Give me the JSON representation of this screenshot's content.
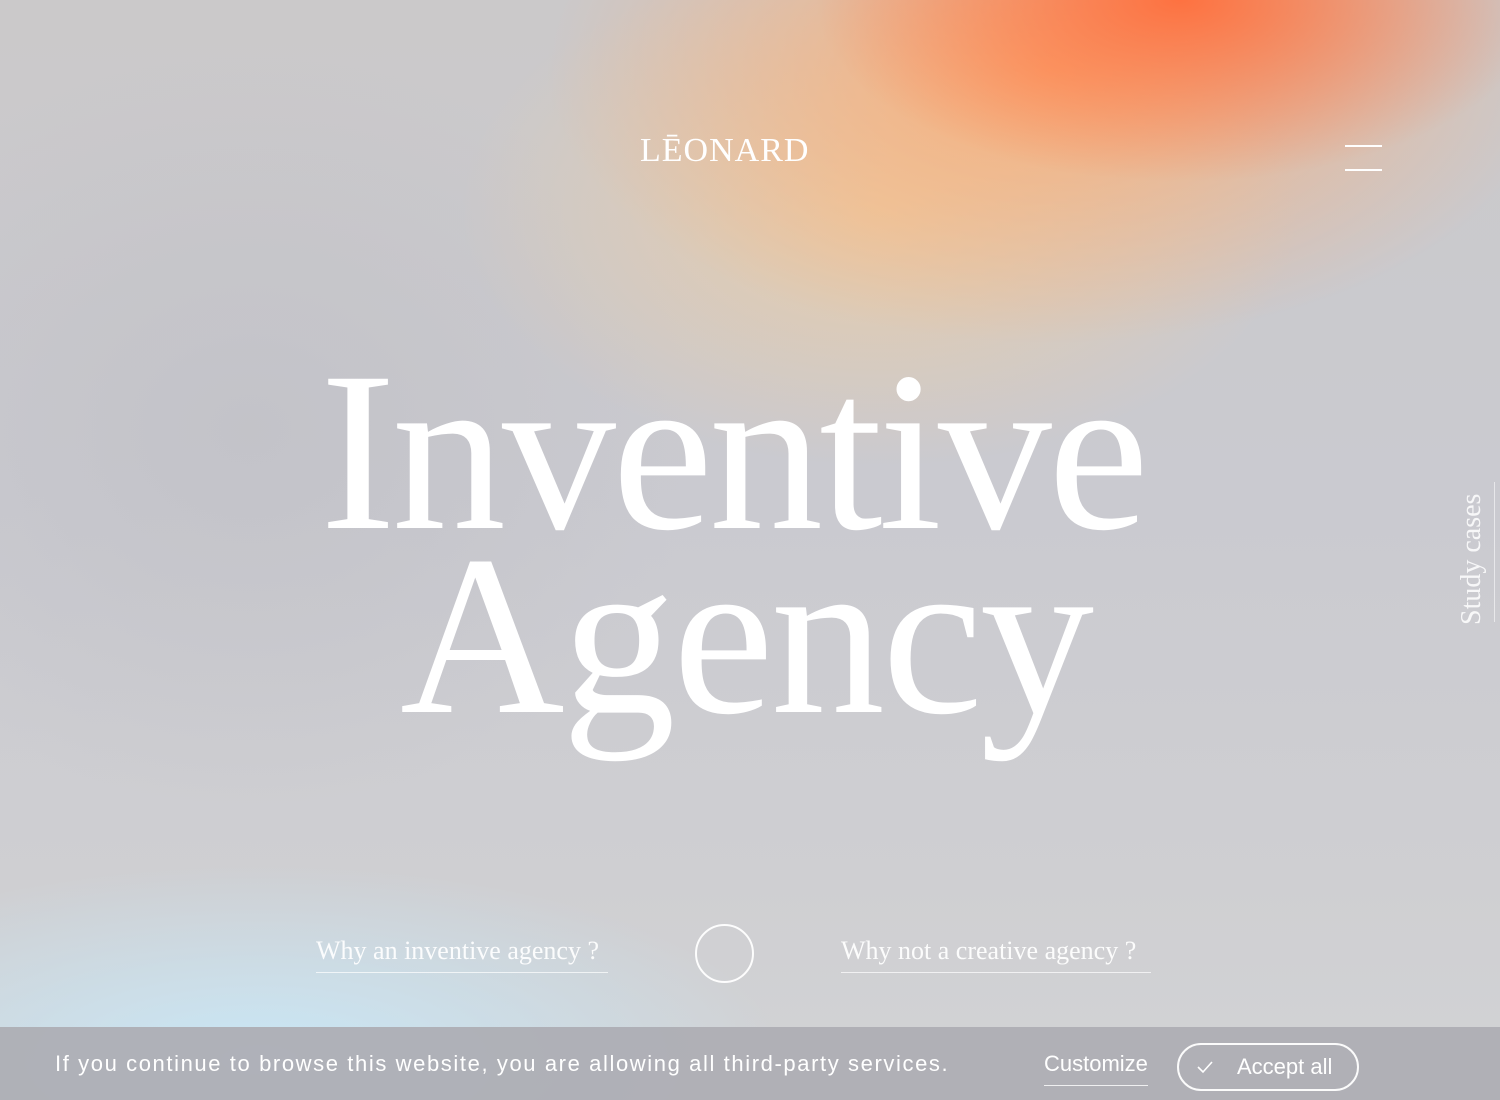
{
  "header": {
    "logo_text": "LĒONARD",
    "menu_icon": "hamburger-menu-icon"
  },
  "hero": {
    "line1": "Inventive",
    "line2": "Agency"
  },
  "side_nav": {
    "study_cases_label": "Study cases"
  },
  "questions": {
    "left_label": "Why an inventive agency ?",
    "right_label": "Why not a creative agency ?"
  },
  "cookie_banner": {
    "message": "If you continue to browse this website, you are allowing all third-party services.",
    "customize_label": "Customize",
    "accept_label": "Accept all",
    "accept_icon": "check-icon"
  },
  "colors": {
    "text": "#ffffff",
    "accent_orange": "#ff6e3c",
    "banner_bg": "#acadb3"
  }
}
